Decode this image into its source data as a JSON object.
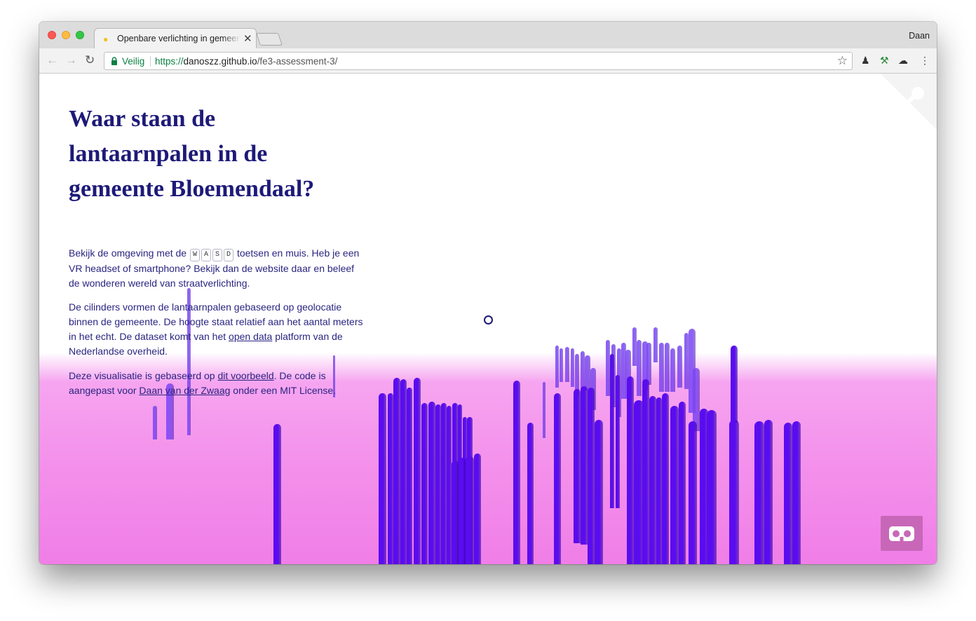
{
  "browser": {
    "tab_title": "Openbare verlichting in gemeente Bloemendaal",
    "profile_name": "Daan",
    "security_label": "Veilig",
    "url_scheme": "https://",
    "url_host": "danoszz.github.io",
    "url_path": "/fe3-assessment-3/"
  },
  "page": {
    "heading": "Waar staan de lantaarnpalen in de gemeente Bloemendaal?",
    "intro_before_keys": "Bekijk de omgeving met de",
    "keys": [
      "W",
      "A",
      "S",
      "D"
    ],
    "intro_after_keys": "toetsen en muis. Heb je een VR headset of smartphone? Bekijk dan de website daar en beleef de wonderen wereld van straatverlichting.",
    "para2_before_link": "De cilinders vormen de lantaarnpalen gebaseerd op geolocatie binnen de gemeente. De hoogte staat relatief aan het aantal meters in het echt. De dataset komt van het",
    "para2_link": "open data",
    "para2_after_link": "platform van de Nederlandse overheid.",
    "para3_before_link1": "Deze visualisatie is gebaseerd op",
    "para3_link1": "dit voorbeeld",
    "para3_middle": ". De code is aangepast voor",
    "para3_link2": "Daan van der Zwaag",
    "para3_after": "onder een MIT License."
  },
  "scene": {
    "bar_color": "#5a0cf0",
    "far_bar_color": "#7a45f5",
    "floor_color": "#f07ee7",
    "vr_button_color": "#c867b8"
  }
}
